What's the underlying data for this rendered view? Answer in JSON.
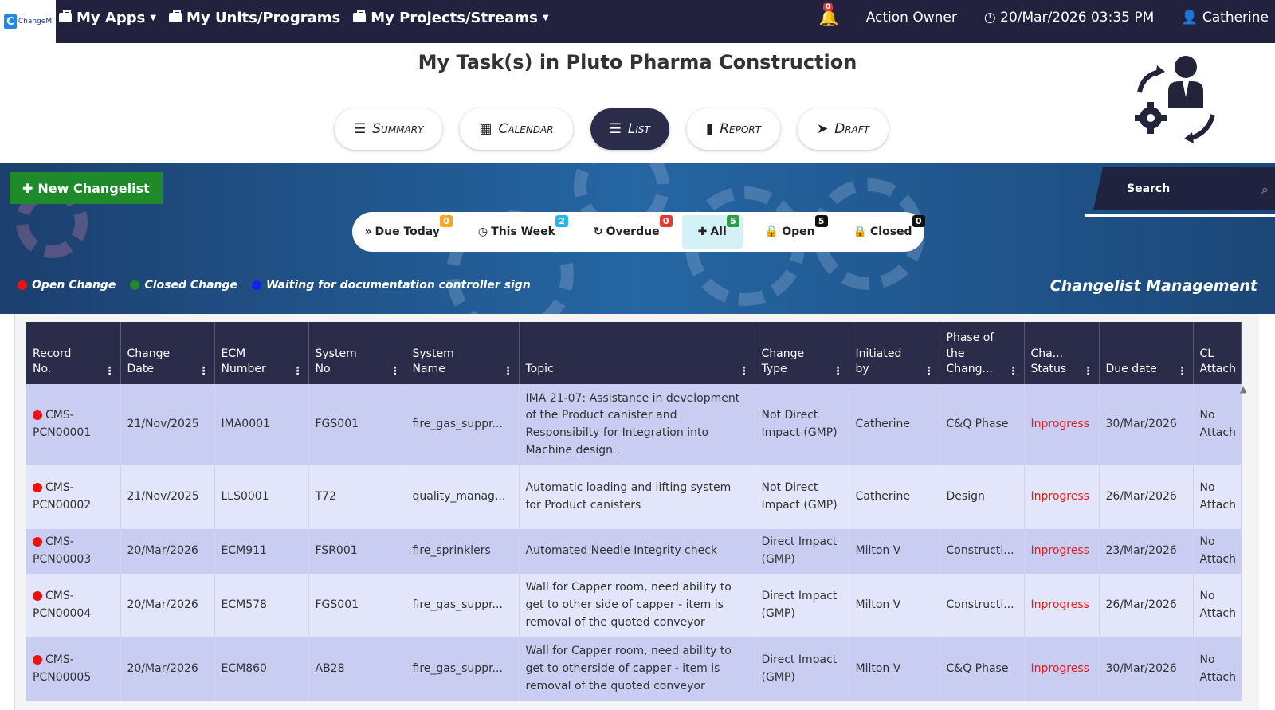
{
  "topnav": {
    "logo_text": "ChangeM",
    "my_apps": "My Apps",
    "my_units": "My Units/Programs",
    "my_projects": "My Projects/Streams",
    "notification_count": "0",
    "role": "Action Owner",
    "datetime": "20/Mar/2026 03:35 PM",
    "user": "Catherine"
  },
  "page_title": "My Task(s) in Pluto Pharma Construction",
  "tabs": [
    "Summary",
    "Calendar",
    "List",
    "Report",
    "Draft"
  ],
  "active_tab": "List",
  "banner": {
    "new_button": "New Changelist",
    "search_label": "Search",
    "filters": [
      {
        "label": "Due Today",
        "count": "0",
        "badge_color": "#f5a623"
      },
      {
        "label": "This Week",
        "count": "2",
        "badge_color": "#29b6e8"
      },
      {
        "label": "Overdue",
        "count": "0",
        "badge_color": "#e53935"
      },
      {
        "label": "All",
        "count": "5",
        "badge_color": "#2e9e44"
      },
      {
        "label": "Open",
        "count": "5",
        "badge_color": "#111111"
      },
      {
        "label": "Closed",
        "count": "0",
        "badge_color": "#111111"
      }
    ],
    "legend": [
      {
        "label": "Open Change",
        "color": "#ee1111"
      },
      {
        "label": "Closed Change",
        "color": "#1f8a2a"
      },
      {
        "label": "Waiting for documentation controller sign",
        "color": "#1122ee"
      }
    ],
    "brand": "Changelist Management"
  },
  "table": {
    "headers": [
      {
        "line1": "Record",
        "line2": "No."
      },
      {
        "line1": "Change",
        "line2": "Date"
      },
      {
        "line1": "ECM",
        "line2": "Number"
      },
      {
        "line1": "System",
        "line2": "No"
      },
      {
        "line1": "System",
        "line2": "Name"
      },
      {
        "line1": "",
        "line2": "Topic"
      },
      {
        "line1": "Change",
        "line2": "Type"
      },
      {
        "line1": "Initiated",
        "line2": "by"
      },
      {
        "line1": "Phase of the",
        "line2": "Chang..."
      },
      {
        "line1": "Cha...",
        "line2": "Status"
      },
      {
        "line1": "",
        "line2": "Due date"
      },
      {
        "line1": "CL",
        "line2": "Attach"
      }
    ],
    "rows": [
      {
        "rec1": "CMS-",
        "rec2": "PCN00001",
        "date": "21/Nov/2025",
        "ecm": "IMA0001",
        "sysno": "FGS001",
        "sysname": "fire_gas_suppr...",
        "topic": "IMA 21-07: Assistance in development of the Product canister and Responsibilty for Integration into Machine design .",
        "type": "Not Direct Impact (GMP)",
        "by": "Catherine",
        "phase": "C&Q Phase",
        "status": "Inprogress",
        "due": "30/Mar/2026",
        "attach": "No Attach"
      },
      {
        "rec1": "CMS-",
        "rec2": "PCN00002",
        "date": "21/Nov/2025",
        "ecm": "LLS0001",
        "sysno": "T72",
        "sysname": "quality_manag...",
        "topic": "Automatic loading and lifting system for Product canisters",
        "type": "Not Direct Impact (GMP)",
        "by": "Catherine",
        "phase": "Design",
        "status": "Inprogress",
        "due": "26/Mar/2026",
        "attach": "No Attach"
      },
      {
        "rec1": "CMS-",
        "rec2": "PCN00003",
        "date": "20/Mar/2026",
        "ecm": "ECM911",
        "sysno": "FSR001",
        "sysname": "fire_sprinklers",
        "topic": "Automated Needle Integrity check",
        "type": "Direct Impact (GMP)",
        "by": "Milton V",
        "phase": "Constructi...",
        "status": "Inprogress",
        "due": "23/Mar/2026",
        "attach": "No Attach"
      },
      {
        "rec1": "CMS-",
        "rec2": "PCN00004",
        "date": "20/Mar/2026",
        "ecm": "ECM578",
        "sysno": "FGS001",
        "sysname": "fire_gas_suppr...",
        "topic": "Wall for Capper room, need ability to get to other side of capper - item is removal of the quoted conveyor",
        "type": "Direct Impact (GMP)",
        "by": "Milton V",
        "phase": "Constructi...",
        "status": "Inprogress",
        "due": "26/Mar/2026",
        "attach": "No Attach"
      },
      {
        "rec1": "CMS-",
        "rec2": "PCN00005",
        "date": "20/Mar/2026",
        "ecm": "ECM860",
        "sysno": "AB28",
        "sysname": "fire_gas_suppr...",
        "topic": "Wall for Capper room, need ability to get to otherside of capper - item is removal of the quoted conveyor",
        "type": "Direct Impact (GMP)",
        "by": "Milton V",
        "phase": "C&Q Phase",
        "status": "Inprogress",
        "due": "30/Mar/2026",
        "attach": "No Attach"
      }
    ]
  }
}
